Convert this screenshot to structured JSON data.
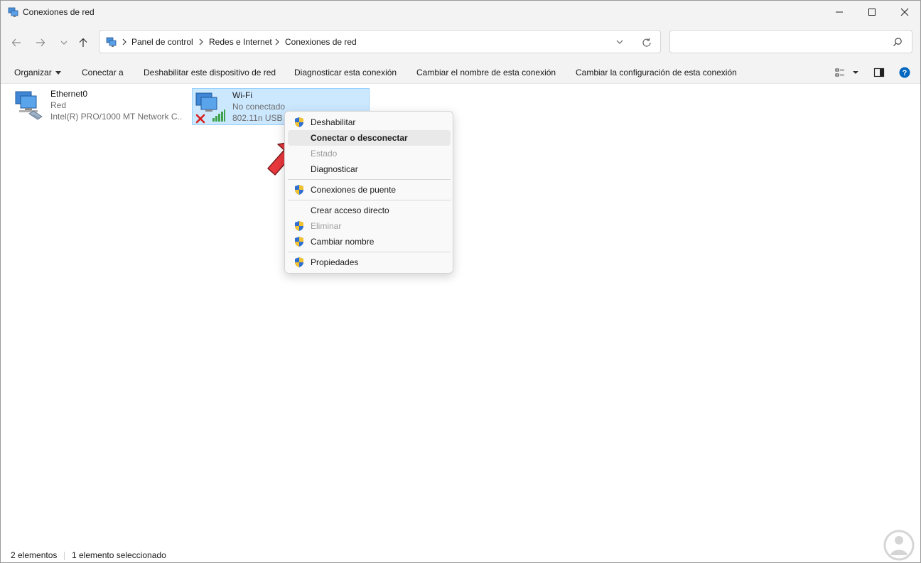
{
  "window": {
    "title": "Conexiones de red"
  },
  "address": {
    "crumbs": [
      "Panel de control",
      "Redes e Internet",
      "Conexiones de red"
    ],
    "search_placeholder": ""
  },
  "commands": {
    "organize": "Organizar",
    "connect": "Conectar a",
    "disable_device": "Deshabilitar este dispositivo de red",
    "diagnose": "Diagnosticar esta conexión",
    "rename": "Cambiar el nombre de esta conexión",
    "change_settings": "Cambiar la configuración de esta conexión"
  },
  "items": [
    {
      "name": "Ethernet0",
      "status": "Red",
      "device": "Intel(R) PRO/1000 MT Network C...",
      "selected": false
    },
    {
      "name": "Wi-Fi",
      "status": "No conectado",
      "device": "802.11n USB W",
      "selected": true
    }
  ],
  "context_menu": {
    "items": [
      {
        "label": "Deshabilitar",
        "shield": true,
        "state": "normal"
      },
      {
        "label": "Conectar o desconectar",
        "shield": false,
        "state": "hover"
      },
      {
        "label": "Estado",
        "shield": false,
        "state": "disabled"
      },
      {
        "label": "Diagnosticar",
        "shield": false,
        "state": "normal"
      },
      {
        "label": "Conexiones de puente",
        "shield": true,
        "state": "normal"
      },
      {
        "label": "Crear acceso directo",
        "shield": false,
        "state": "normal"
      },
      {
        "label": "Eliminar",
        "shield": true,
        "state": "disabled"
      },
      {
        "label": "Cambiar nombre",
        "shield": true,
        "state": "normal"
      },
      {
        "label": "Propiedades",
        "shield": true,
        "state": "normal"
      }
    ]
  },
  "statusbar": {
    "count": "2 elementos",
    "selected": "1 elemento seleccionado"
  },
  "colors": {
    "selection_bg": "#cce8ff",
    "selection_border": "#99d1ff",
    "accent": "#0067c0",
    "annotation": "#e8383d"
  }
}
